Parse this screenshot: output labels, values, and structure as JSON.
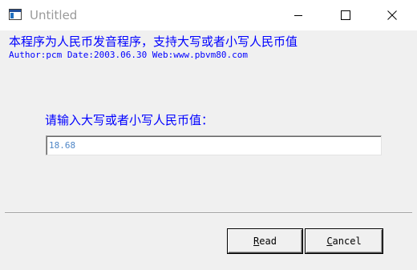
{
  "window": {
    "title": "Untitled",
    "controls": {
      "minimize_glyph": "—",
      "maximize_glyph": "☐",
      "close_glyph": "✕"
    },
    "icon": "app-window-icon"
  },
  "header": {
    "line1": "本程序为人民币发音程序，支持大写或者小写人民币值",
    "line2": "Author:pcm Date:2003.06.30 Web:www.pbvm80.com"
  },
  "form": {
    "prompt": "请输入大写或者小写人民币值：",
    "amount_value": "18.68"
  },
  "buttons": {
    "read_label": "Read",
    "cancel_label": "Cancel"
  },
  "colors": {
    "label_text": "#0000ff",
    "input_text": "#4f86c6",
    "title_text": "#9a9a9a",
    "dialog_bg": "#f0f0f0"
  }
}
